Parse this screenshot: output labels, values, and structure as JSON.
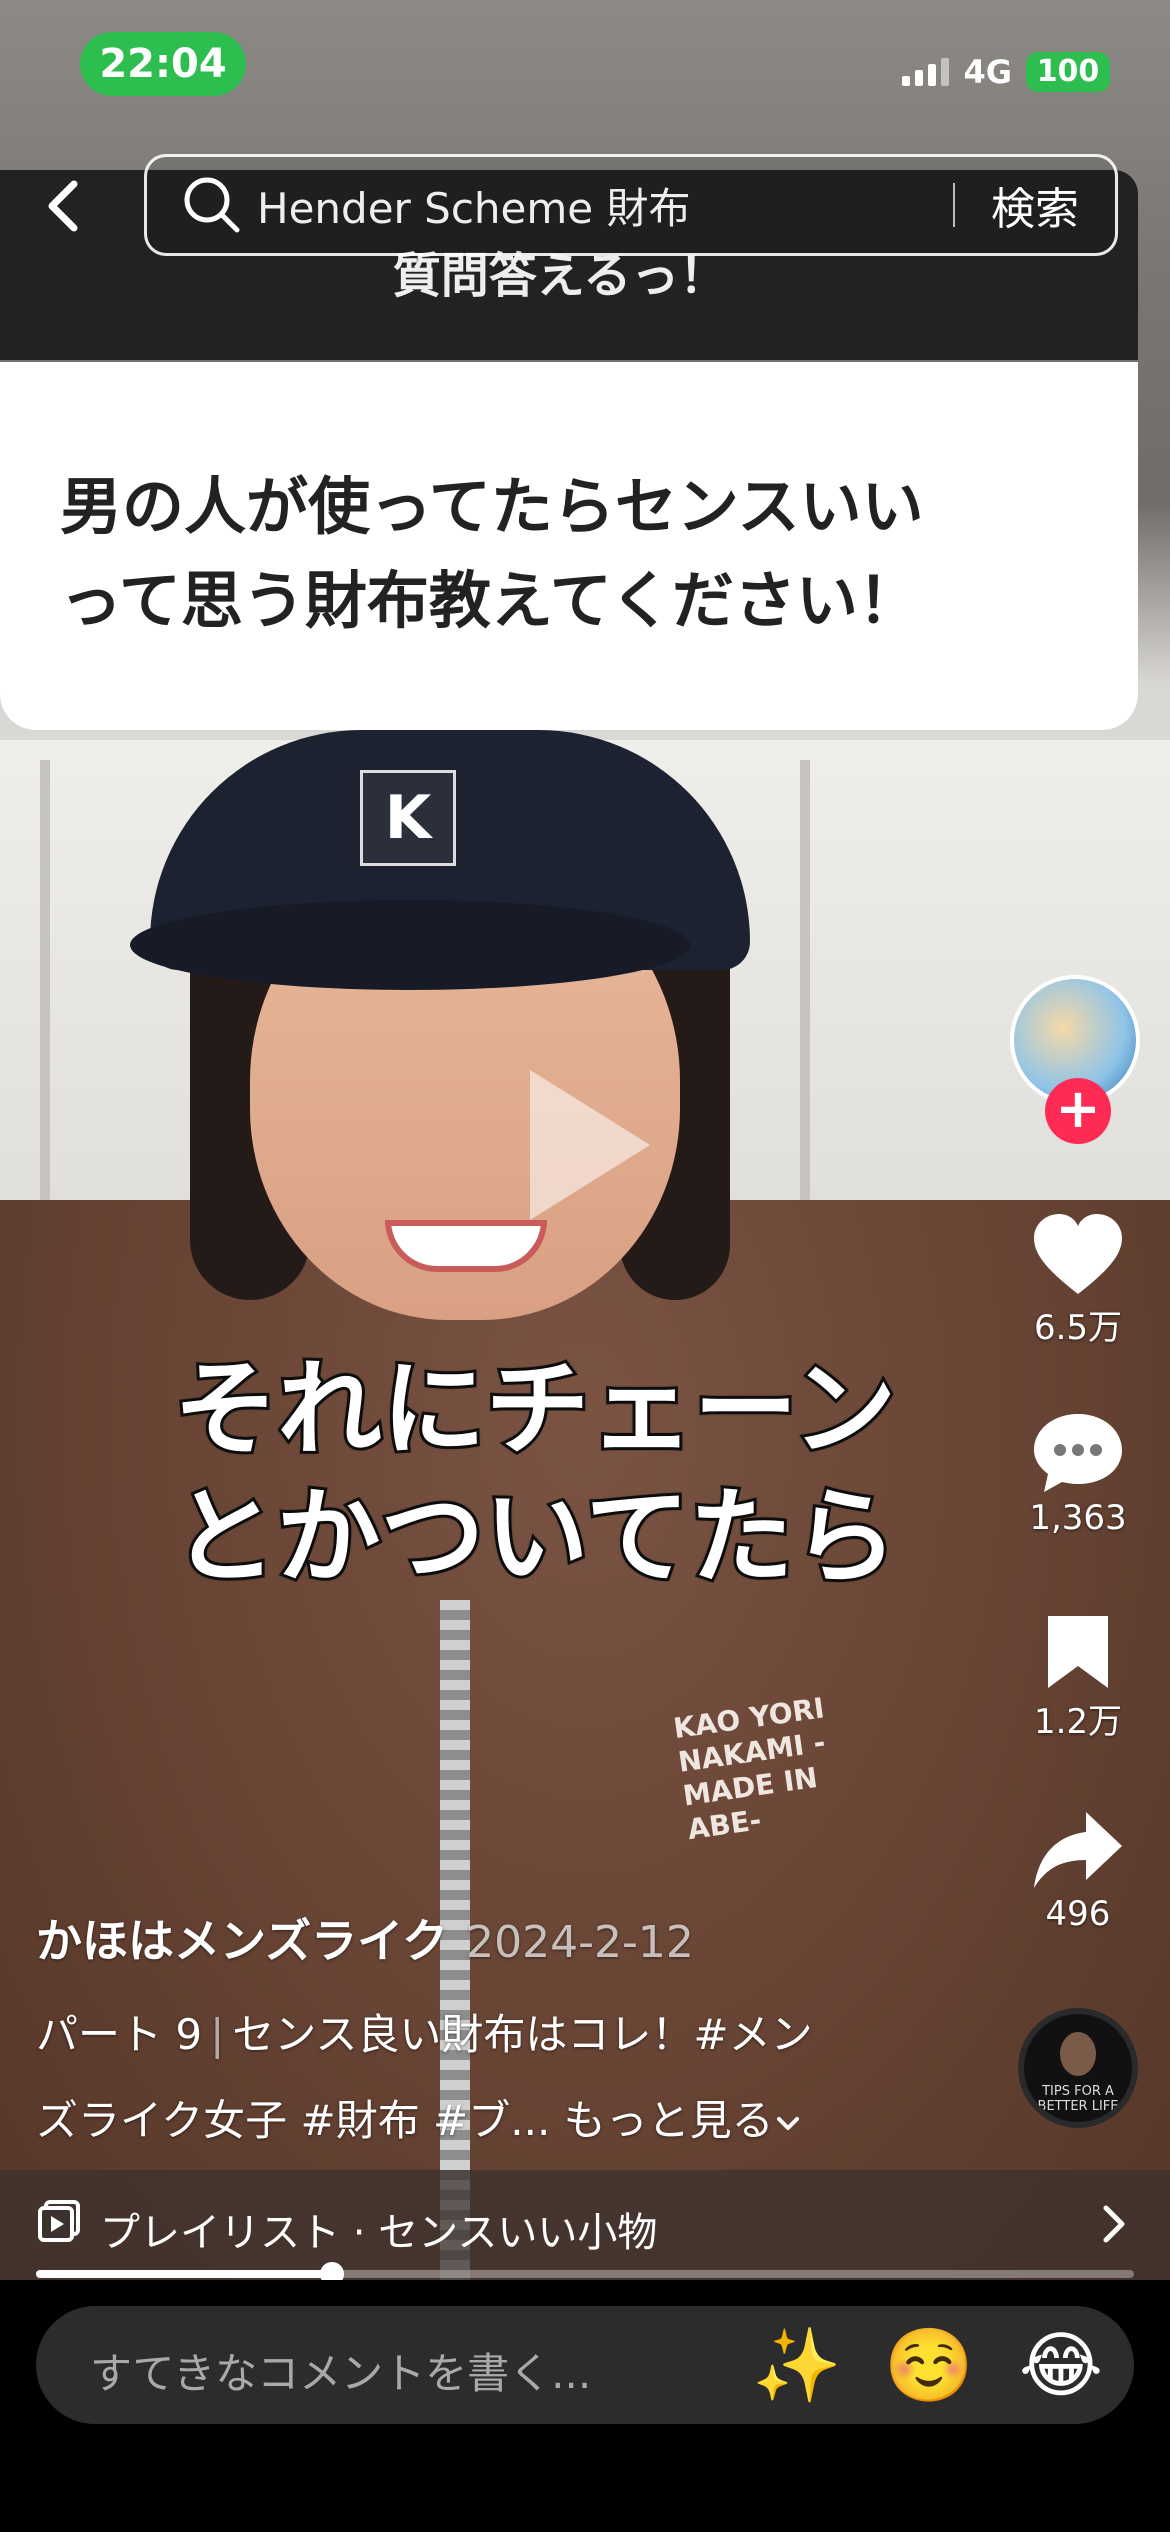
{
  "status_bar": {
    "time": "22:04",
    "network": "4G",
    "battery": "100"
  },
  "search": {
    "query": "Hender Scheme 財布",
    "button_label": "検索"
  },
  "question_card": {
    "header": "質問答えるっ！",
    "text_line1": "男の人が使ってたらセンスいい",
    "text_line2": "って思う財布教えてください！"
  },
  "video_caption": {
    "line1": "それにチェーン",
    "line2": "とかついてたら"
  },
  "hoodie_print": "KAO YORI NAKAMI -MADE IN ABE-",
  "actions": {
    "likes": "6.5万",
    "comments": "1,363",
    "bookmarks": "1.2万",
    "shares": "496"
  },
  "music_disc_text": "TIPS FOR A BETTER LIFE",
  "post": {
    "author": "かほはメンズライク",
    "date": "2024-2-12",
    "desc_part": "パート 9",
    "desc_separator": "|",
    "desc_line1_rest": "センス良い財布はコレ！#メン",
    "desc_line2": "ズライク女子 #財布 #ブ...",
    "more_label": "もっと見る"
  },
  "playlist": {
    "label": "プレイリスト · センスいい小物"
  },
  "progress": {
    "fraction": 0.27
  },
  "comment_bar": {
    "placeholder": "すてきなコメントを書く...",
    "emojis": [
      "✨",
      "☺️",
      "😂"
    ]
  },
  "colors": {
    "accent": "#fe2c55",
    "status_green": "#2ebd4f"
  }
}
